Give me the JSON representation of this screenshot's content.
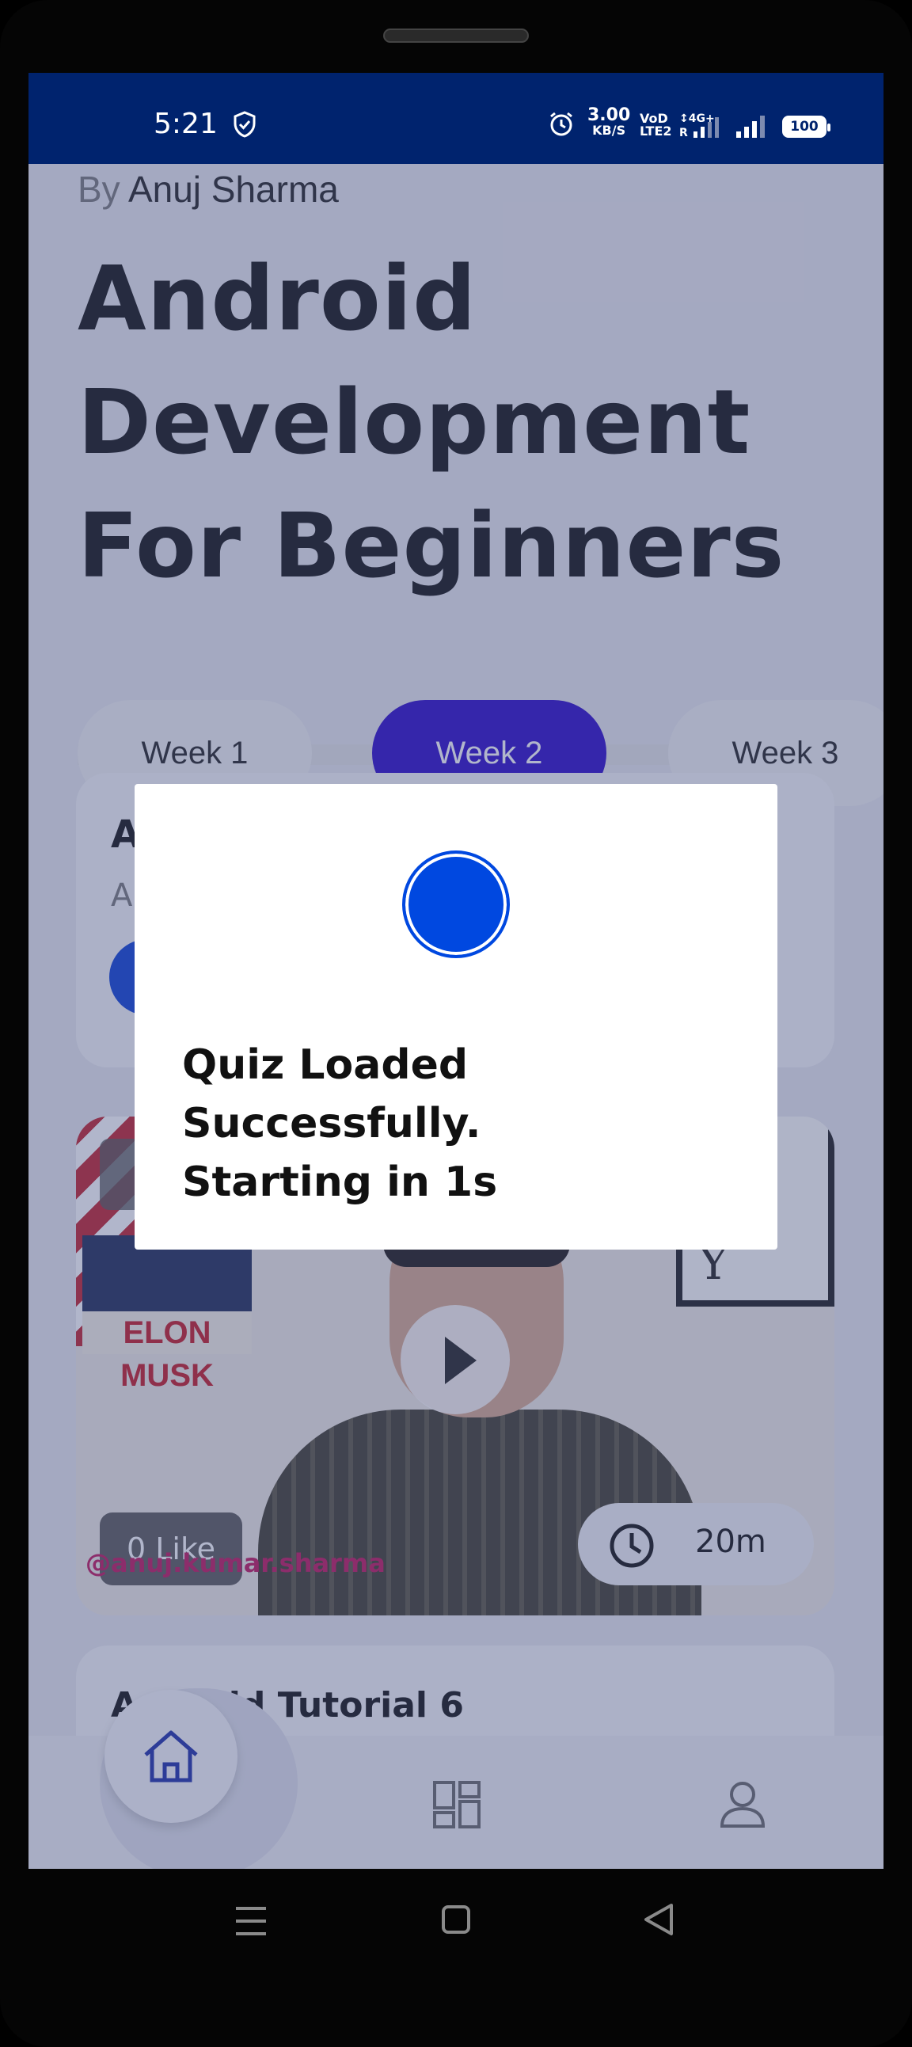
{
  "status_bar": {
    "time": "5:21",
    "net_speed_value": "3.00",
    "net_speed_unit": "KB/S",
    "volte_line1": "VoD",
    "volte_line2": "LTE2",
    "battery": "100"
  },
  "course": {
    "author_prefix": "By",
    "author_name": "Anuj Sharma",
    "title": "Android Development For Beginners"
  },
  "tabs": [
    {
      "label": "Week 1",
      "active": false
    },
    {
      "label": "Week 2",
      "active": true
    },
    {
      "label": "Week 3",
      "active": false
    }
  ],
  "cards": {
    "card_a_title": "A",
    "card_a_subtitle": "A",
    "video": {
      "book_text": "ELON MUSK",
      "frame_text": "d\nes\nY",
      "likes": "0 Like",
      "watermark": "@anuj.kumar.sharma",
      "duration": "20m"
    },
    "card_c_title": "Android Tutorial 6"
  },
  "dialog": {
    "message": "Quiz Loaded Successfully.\nStarting in 1s"
  },
  "icons": {
    "accent": "#2a08c8",
    "status_bar_bg": "#00236e",
    "dialog_circle": "#0048e0"
  }
}
